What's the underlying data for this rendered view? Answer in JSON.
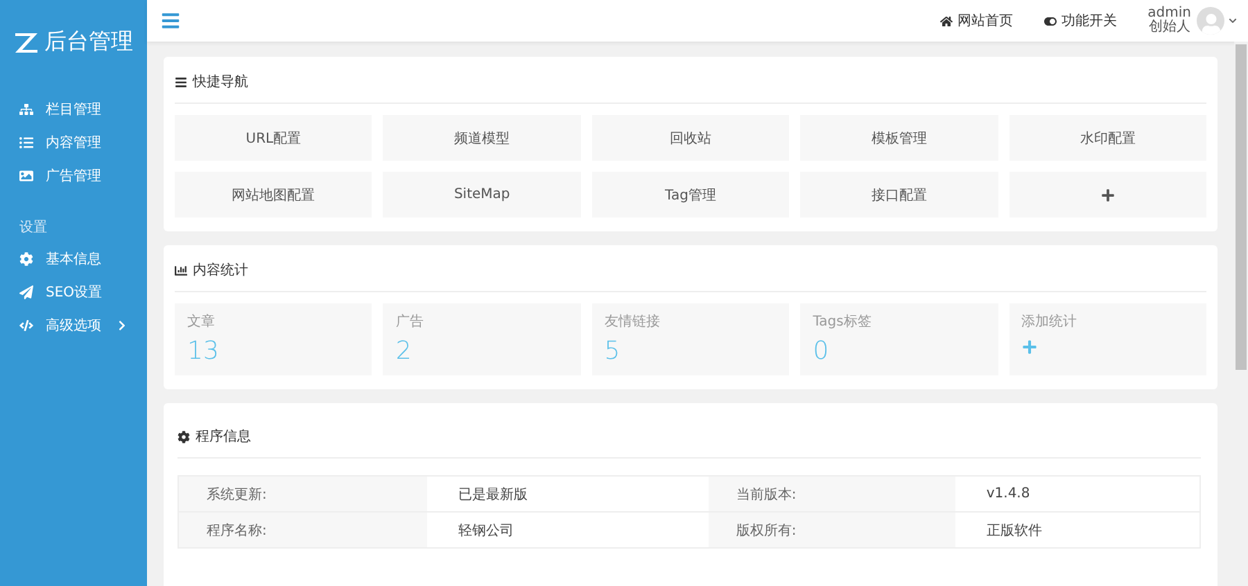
{
  "sidebar": {
    "logo": "后台管理",
    "items": [
      {
        "label": "栏目管理",
        "kind": "sitemap"
      },
      {
        "label": "内容管理",
        "kind": "list"
      },
      {
        "label": "广告管理",
        "kind": "image"
      }
    ],
    "section": "设置",
    "settings": [
      {
        "label": "基本信息",
        "kind": "gear",
        "expandable": false
      },
      {
        "label": "SEO设置",
        "kind": "plane",
        "expandable": false
      },
      {
        "label": "高级选项",
        "kind": "code",
        "expandable": true
      }
    ]
  },
  "topbar": {
    "links": [
      {
        "label": "网站首页",
        "kind": "home"
      },
      {
        "label": "功能开关",
        "kind": "toggle"
      }
    ],
    "user": {
      "name": "admin",
      "role": "创始人"
    }
  },
  "quick_nav": {
    "title": "快捷导航",
    "items": [
      {
        "kind": "text",
        "label": "URL配置"
      },
      {
        "kind": "text",
        "label": "频道模型"
      },
      {
        "kind": "text",
        "label": "回收站"
      },
      {
        "kind": "text",
        "label": "模板管理"
      },
      {
        "kind": "text",
        "label": "水印配置"
      },
      {
        "kind": "text",
        "label": "网站地图配置"
      },
      {
        "kind": "text",
        "label": "SiteMap"
      },
      {
        "kind": "text",
        "label": "Tag管理"
      },
      {
        "kind": "text",
        "label": "接口配置"
      },
      {
        "kind": "add"
      }
    ]
  },
  "stats": {
    "title": "内容统计",
    "items": [
      {
        "kind": "count",
        "label": "文章",
        "value": "13"
      },
      {
        "kind": "count",
        "label": "广告",
        "value": "2"
      },
      {
        "kind": "count",
        "label": "友情链接",
        "value": "5"
      },
      {
        "kind": "count",
        "label": "Tags标签",
        "value": "0"
      },
      {
        "kind": "add",
        "label": "添加统计"
      }
    ]
  },
  "program_info": {
    "title": "程序信息",
    "rows": [
      [
        "系统更新:",
        "已是最新版",
        "当前版本:",
        "v1.4.8"
      ],
      [
        "程序名称:",
        "轻钢公司",
        "版权所有:",
        "正版软件"
      ]
    ]
  }
}
